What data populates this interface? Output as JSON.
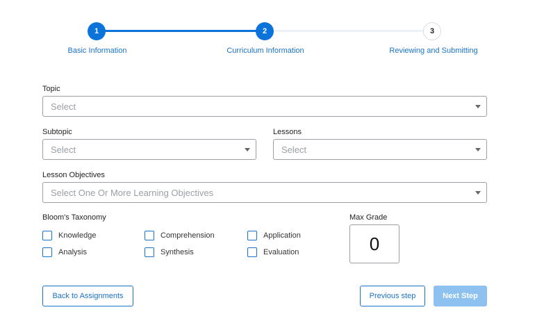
{
  "stepper": {
    "steps": [
      {
        "number": "1",
        "label": "Basic Information",
        "state": "complete"
      },
      {
        "number": "2",
        "label": "Curriculum Information",
        "state": "active"
      },
      {
        "number": "3",
        "label": "Reviewing and Submitting",
        "state": "pending"
      }
    ]
  },
  "form": {
    "topic": {
      "label": "Topic",
      "placeholder": "Select"
    },
    "subtopic": {
      "label": "Subtopic",
      "placeholder": "Select"
    },
    "lessons": {
      "label": "Lessons",
      "placeholder": "Select"
    },
    "objectives": {
      "label": "Lesson Objectives",
      "placeholder": "Select One Or More Learning Objectives"
    },
    "blooms": {
      "label": "Bloom's Taxonomy",
      "options": [
        "Knowledge",
        "Comprehension",
        "Application",
        "Analysis",
        "Synthesis",
        "Evaluation"
      ]
    },
    "max_grade": {
      "label": "Max Grade",
      "value": "0"
    }
  },
  "buttons": {
    "back": "Back to Assignments",
    "previous": "Previous step",
    "next": "Next Step"
  },
  "colors": {
    "accent": "#0b73d9",
    "link": "#1a73c9",
    "disabled_primary": "#8cc1f0"
  }
}
